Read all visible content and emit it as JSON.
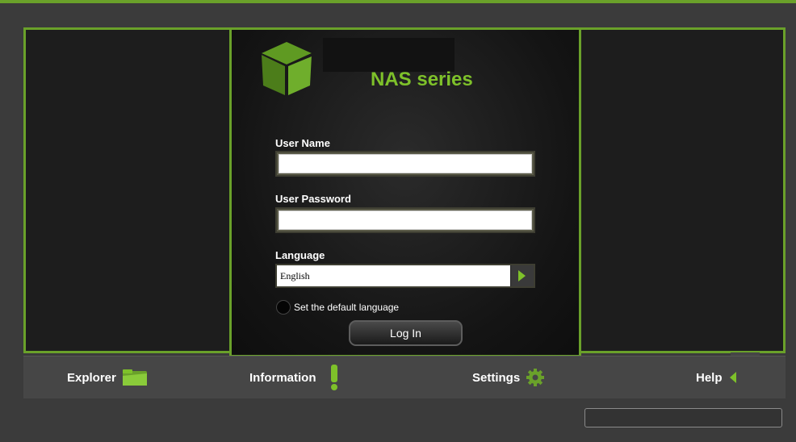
{
  "brand": {
    "title": "NAS series",
    "logo_icon": "green-cube-logo-icon"
  },
  "login": {
    "username_label": "User Name",
    "username_value": "",
    "password_label": "User Password",
    "password_value": "",
    "language_label": "Language",
    "language_value": "English",
    "default_language_label": "Set the default language",
    "login_button": "Log In"
  },
  "nav": {
    "items": [
      {
        "label": "Explorer",
        "icon": "folder-icon"
      },
      {
        "label": "Information",
        "icon": "exclamation-icon"
      },
      {
        "label": "Settings",
        "icon": "gear-icon"
      },
      {
        "label": "Help",
        "icon": "triangle-left-icon"
      }
    ]
  },
  "colors": {
    "accent": "#6aa12a",
    "brand_text": "#7ec12a",
    "background": "#3b3b3b",
    "panel": "#141414"
  }
}
